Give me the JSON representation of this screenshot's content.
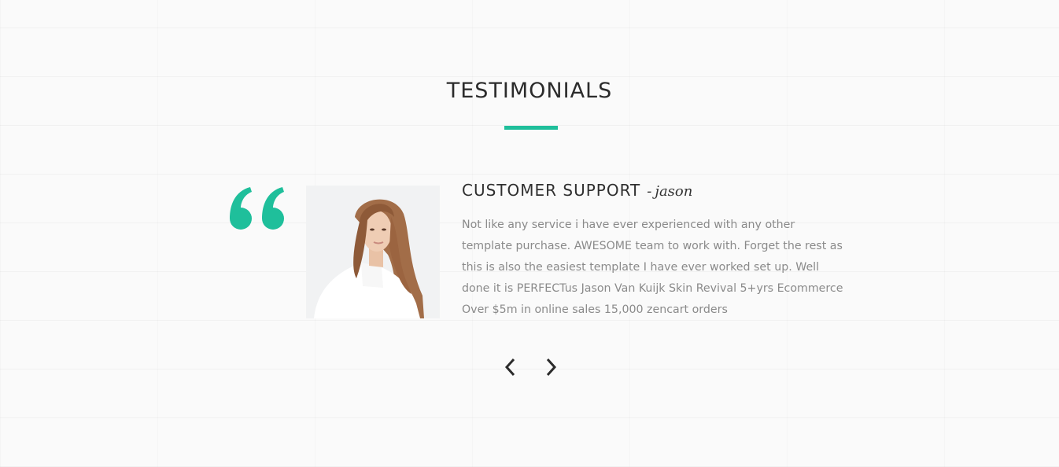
{
  "section": {
    "title": "TESTIMONIALS",
    "accent_color": "#1fbf9b"
  },
  "testimonial": {
    "subject": "CUSTOMER SUPPORT",
    "separator": "-",
    "author": "jason",
    "body": "Not like any service i have ever experienced with any other template purchase. AWESOME team to work with. Forget the rest as this is also the easiest template I have ever worked set up. Well done it is PERFECTus Jason Van Kuijk Skin Revival 5+yrs Ecommerce Over $5m in online sales 15,000 zencart orders",
    "quote_icon": "quote-icon",
    "photo_icon": "customer-photo"
  },
  "carousel": {
    "prev_icon": "chevron-left-icon",
    "next_icon": "chevron-right-icon"
  }
}
